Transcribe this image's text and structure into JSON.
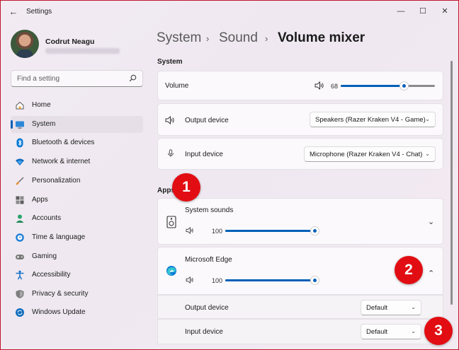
{
  "window": {
    "title": "Settings",
    "back_glyph": "←",
    "min_glyph": "—",
    "max_glyph": "☐",
    "close_glyph": "✕"
  },
  "user": {
    "name": "Codrut Neagu"
  },
  "search": {
    "placeholder": "Find a setting"
  },
  "nav": {
    "items": [
      {
        "label": "Home",
        "icon": "home-icon"
      },
      {
        "label": "System",
        "icon": "system-icon",
        "active": true
      },
      {
        "label": "Bluetooth & devices",
        "icon": "bluetooth-icon"
      },
      {
        "label": "Network & internet",
        "icon": "wifi-icon"
      },
      {
        "label": "Personalization",
        "icon": "brush-icon"
      },
      {
        "label": "Apps",
        "icon": "apps-icon"
      },
      {
        "label": "Accounts",
        "icon": "accounts-icon"
      },
      {
        "label": "Time & language",
        "icon": "globe-clock-icon"
      },
      {
        "label": "Gaming",
        "icon": "gamepad-icon"
      },
      {
        "label": "Accessibility",
        "icon": "accessibility-icon"
      },
      {
        "label": "Privacy & security",
        "icon": "shield-icon"
      },
      {
        "label": "Windows Update",
        "icon": "update-icon"
      }
    ]
  },
  "breadcrumb": {
    "items": [
      "System",
      "Sound",
      "Volume mixer"
    ],
    "separator": "›"
  },
  "system_section": {
    "heading": "System",
    "volume": {
      "label": "Volume",
      "value": "68",
      "level": 0.68
    },
    "output": {
      "label": "Output device",
      "selected": "Speakers (Razer Kraken V4 - Game)"
    },
    "input": {
      "label": "Input device",
      "selected": "Microphone (Razer Kraken V4 - Chat)"
    }
  },
  "apps_section": {
    "heading": "Apps",
    "system_sounds": {
      "label": "System sounds",
      "value": "100",
      "level": 1.0
    },
    "edge": {
      "label": "Microsoft Edge",
      "value": "100",
      "level": 1.0,
      "output": {
        "label": "Output device",
        "selected": "Default"
      },
      "input": {
        "label": "Input device",
        "selected": "Default"
      }
    }
  },
  "annotations": [
    "1",
    "2",
    "3"
  ],
  "colors": {
    "accent": "#005fb8",
    "badge": "#e10d12",
    "frame": "#c0162e"
  },
  "chevron_down": "⌄",
  "chevron_up": "⌃"
}
